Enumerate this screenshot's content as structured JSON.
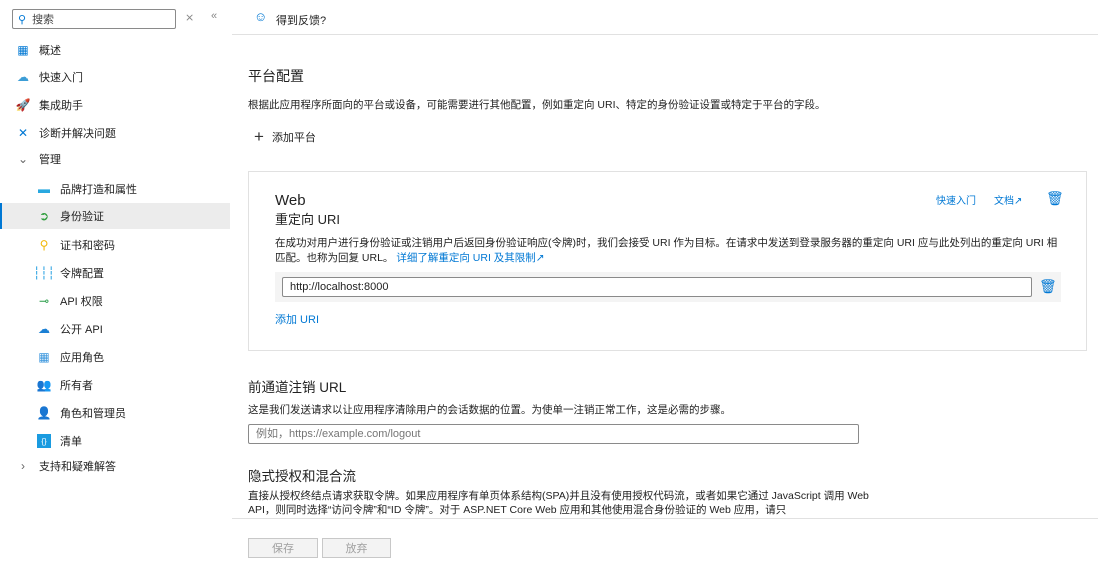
{
  "sidebar": {
    "search_placeholder": "搜索",
    "items": [
      {
        "label": "概述",
        "icon": "grid-icon"
      },
      {
        "label": "快速入门",
        "icon": "cloud-icon"
      },
      {
        "label": "集成助手",
        "icon": "rocket-icon"
      },
      {
        "label": "诊断并解决问题",
        "icon": "tools-icon"
      }
    ],
    "manage_label": "管理",
    "sub_items": [
      {
        "label": "品牌打造和属性"
      },
      {
        "label": "身份验证"
      },
      {
        "label": "证书和密码"
      },
      {
        "label": "令牌配置"
      },
      {
        "label": "API 权限"
      },
      {
        "label": "公开 API"
      },
      {
        "label": "应用角色"
      },
      {
        "label": "所有者"
      },
      {
        "label": "角色和管理员"
      },
      {
        "label": "清单"
      }
    ],
    "support_label": "支持和疑难解答"
  },
  "topbar": {
    "feedback": "得到反馈?"
  },
  "platform": {
    "title": "平台配置",
    "description": "根据此应用程序所面向的平台或设备，可能需要进行其他配置，例如重定向 URI、特定的身份验证设置或特定于平台的字段。",
    "add_platform": "添加平台"
  },
  "web_card": {
    "title": "Web",
    "subtitle": "重定向 URI",
    "quickstart": "快速入门",
    "docs": "文档",
    "description": "在成功对用户进行身份验证或注销用户后返回身份验证响应(令牌)时，我们会接受 URI 作为目标。在请求中发送到登录服务器的重定向 URI 应与此处列出的重定向 URI 相匹配。也称为回复 URL。",
    "learn_more": "详细了解重定向 URI 及其限制",
    "uri_value": "http://localhost:8000",
    "add_uri": "添加 URI"
  },
  "frontchannel": {
    "title": "前通道注销 URL",
    "description": "这是我们发送请求以让应用程序清除用户的会话数据的位置。为使单一注销正常工作，这是必需的步骤。",
    "placeholder": "例如，https://example.com/logout"
  },
  "implicit": {
    "title": "隐式授权和混合流",
    "description": "直接从授权终结点请求获取令牌。如果应用程序有单页体系结构(SPA)并且没有使用授权代码流，或者如果它通过 JavaScript 调用 Web API，则同时选择“访问令牌”和“ID 令牌”。对于 ASP.NET Core Web 应用和其他使用混合身份验证的 Web 应用，请只"
  },
  "footer": {
    "save": "保存",
    "discard": "放弃"
  }
}
